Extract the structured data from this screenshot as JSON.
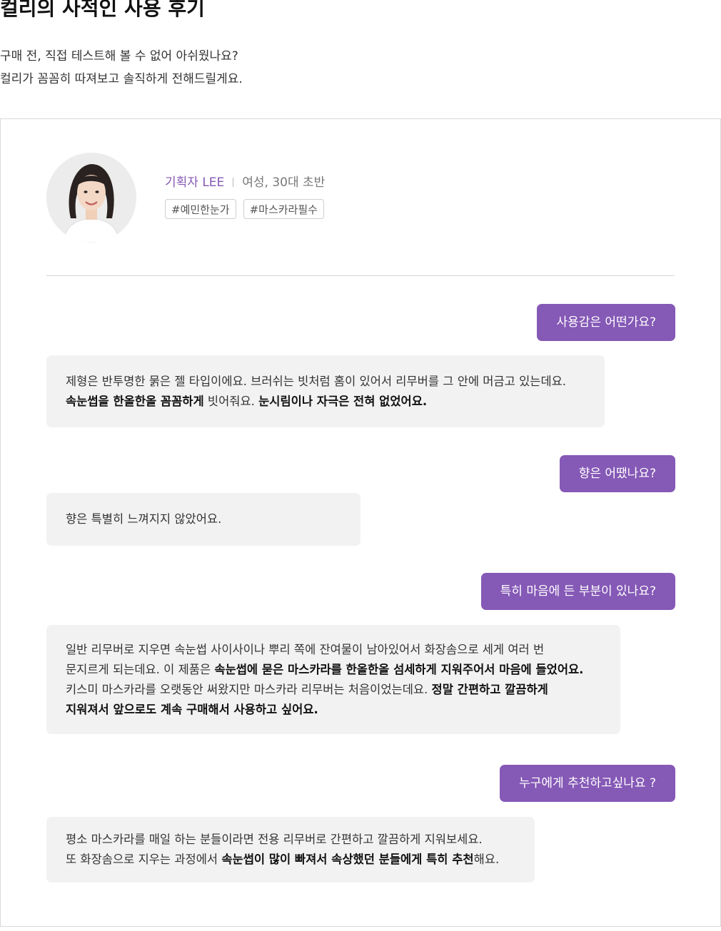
{
  "header": {
    "title": "컬리의 사적인 사용 후기",
    "intro": [
      "구매 전, 직접 테스트해 볼 수 없어 아쉬웠나요?",
      "컬리가 꼼꼼히 따져보고 솔직하게 전해드릴게요."
    ]
  },
  "profile": {
    "role": "기획자 LEE",
    "meta": "여성, 30대 초반",
    "tags": [
      "#예민한눈가",
      "#마스카라필수"
    ]
  },
  "colors": {
    "accent": "#8559b6",
    "bubble_bg": "#f2f2f2",
    "border": "#d9d9d9"
  },
  "qa": [
    {
      "question": "사용감은 어떤가요?",
      "answer": [
        [
          {
            "t": "제형은 반투명한 묽은 젤 타입이에요. 브러쉬는 빗처럼 홈이 있어서 리무버를 그 안에 머금고 있는데요.",
            "b": false
          }
        ],
        [
          {
            "t": "속눈썹을 한올한올 꼼꼼하게",
            "b": true
          },
          {
            "t": " 빗어줘요. ",
            "b": false
          },
          {
            "t": "눈시림이나 자극은 전혀 없었어요.",
            "b": true
          }
        ]
      ]
    },
    {
      "question": "향은 어땠나요?",
      "answer": [
        [
          {
            "t": "향은 특별히 느껴지지 않았어요.",
            "b": false
          }
        ]
      ]
    },
    {
      "question": "특히 마음에 든 부분이 있나요?",
      "answer": [
        [
          {
            "t": "일반 리무버로 지우면 속눈썹 사이사이나 뿌리 쪽에 잔여물이 남아있어서 화장솜으로 세게 여러 번",
            "b": false
          }
        ],
        [
          {
            "t": "문지르게 되는데요. 이 제품은 ",
            "b": false
          },
          {
            "t": "속눈썹에 묻은 마스카라를 한올한올 섬세하게 지워주어서 마음에 들었어요.",
            "b": true
          }
        ],
        [
          {
            "t": "키스미 마스카라를 오랫동안 써왔지만 마스카라 리무버는 처음이었는데요. ",
            "b": false
          },
          {
            "t": "정말 간편하고 깔끔하게",
            "b": true
          }
        ],
        [
          {
            "t": "지워져서 앞으로도 계속 구매해서 사용하고 싶어요.",
            "b": true
          }
        ]
      ]
    },
    {
      "question": "누구에게 추천하고싶나요 ?",
      "answer": [
        [
          {
            "t": "평소 마스카라를 매일 하는 분들이라면 전용 리무버로 간편하고 깔끔하게 지워보세요.",
            "b": false
          }
        ],
        [
          {
            "t": "또 화장솜으로 지우는 과정에서 ",
            "b": false
          },
          {
            "t": "속눈썹이 많이 빠져서 속상했던 분들에게 특히 추천",
            "b": true
          },
          {
            "t": "해요.",
            "b": false
          }
        ]
      ]
    }
  ]
}
